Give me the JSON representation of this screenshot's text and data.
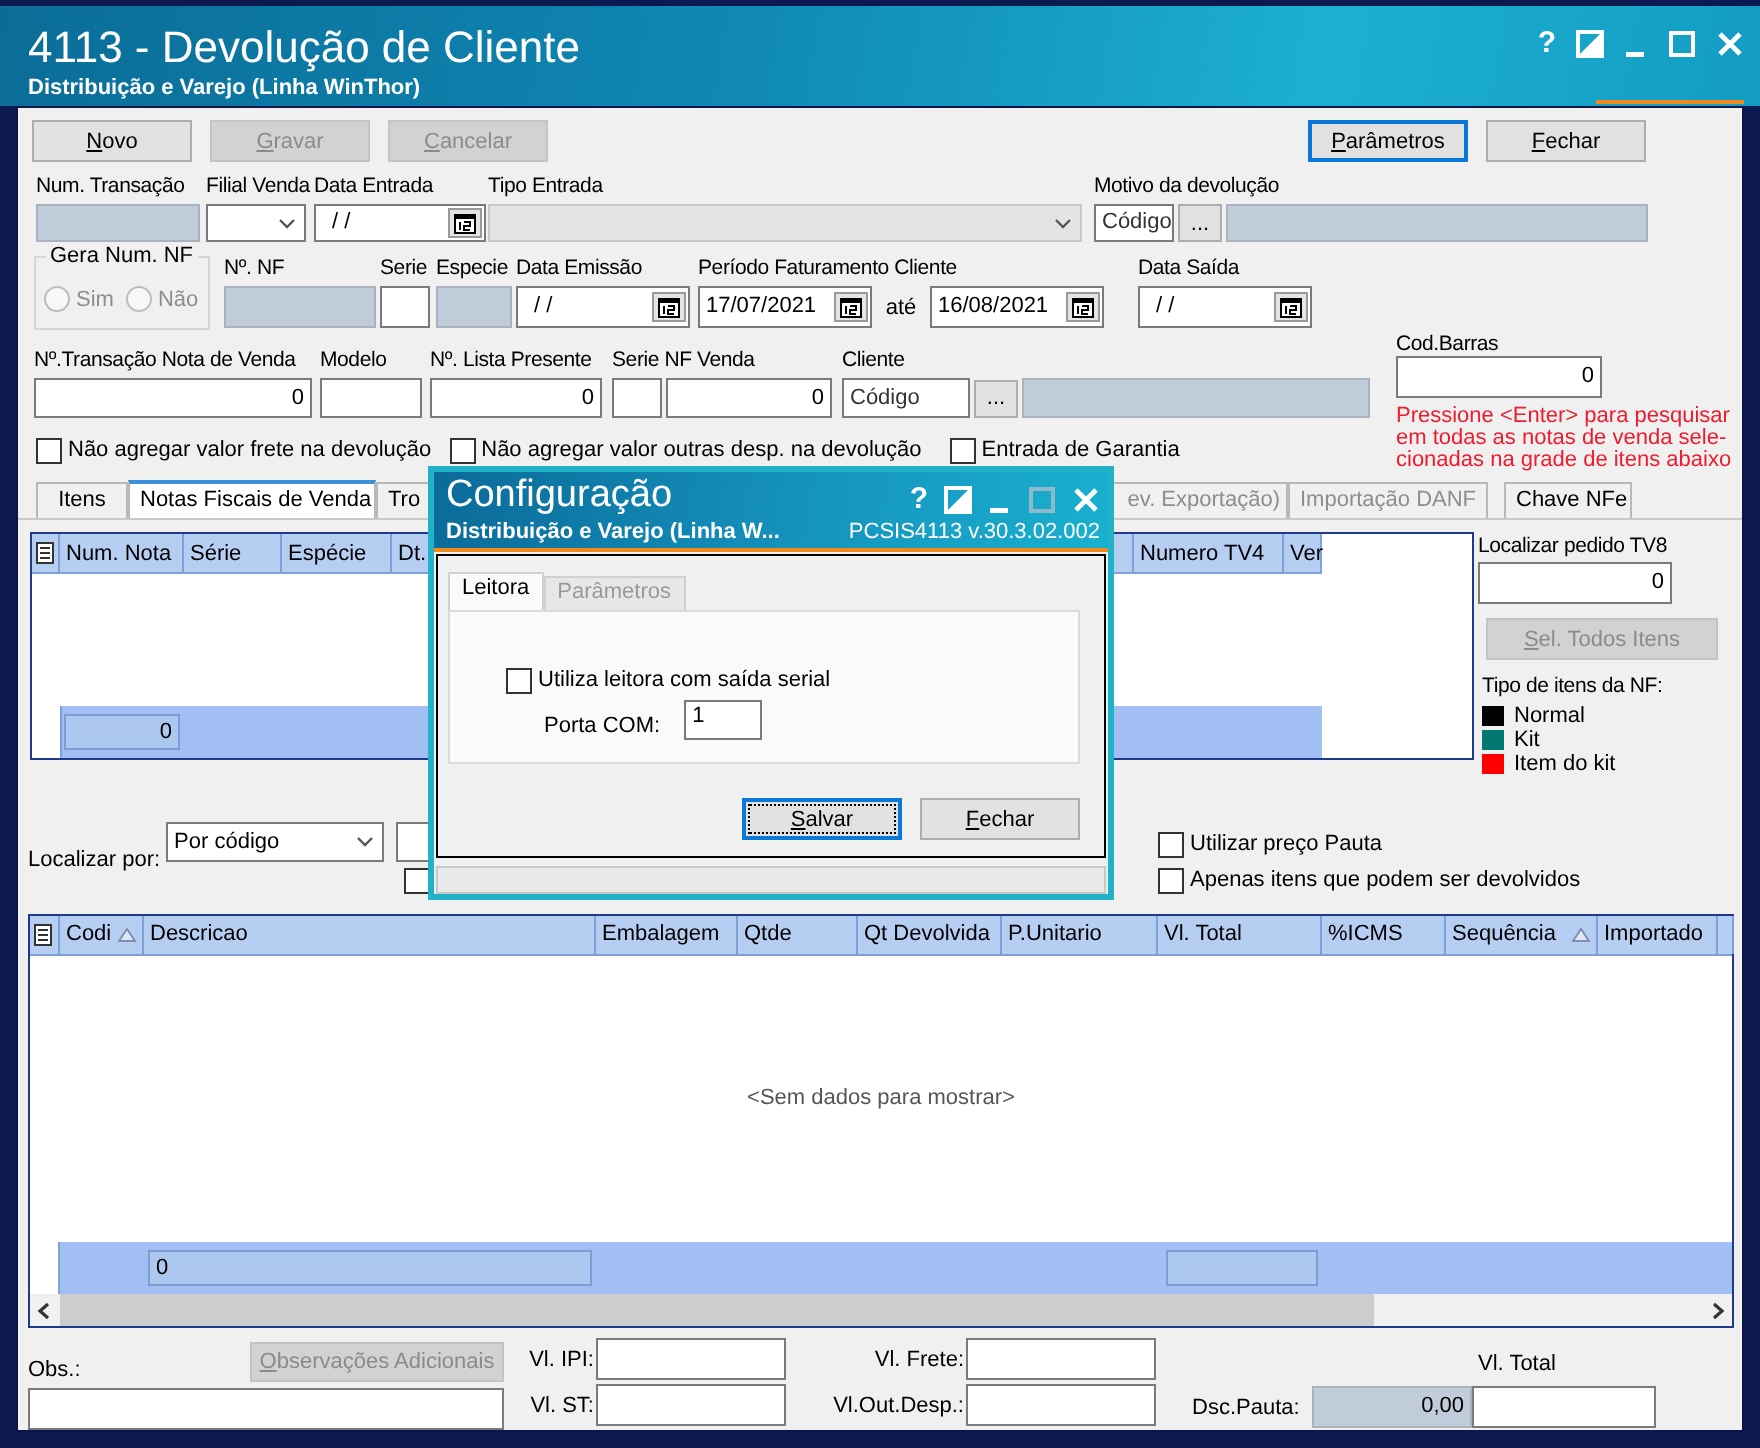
{
  "window": {
    "title": "4113 - Devolução de Cliente",
    "subtitle": "Distribuição e Varejo (Linha WinThor)",
    "help": "?",
    "maximize_disabled": false
  },
  "toolbar": [
    {
      "label": "Novo",
      "disabled": false,
      "focused": false
    },
    {
      "label": "Gravar",
      "disabled": true,
      "focused": false
    },
    {
      "label": "Cancelar",
      "disabled": true,
      "focused": false
    },
    {
      "label": "Parâmetros",
      "disabled": false,
      "focused": true
    },
    {
      "label": "Fechar",
      "disabled": false,
      "focused": false
    }
  ],
  "rows": [
    [
      {
        "kind": "readonly",
        "label": "Num. Transação"
      },
      {
        "kind": "combo",
        "label": "Filial Venda",
        "disabled": false
      },
      {
        "kind": "date",
        "label": "Data Entrada",
        "value": "/ /"
      },
      {
        "kind": "combo",
        "label": "Tipo Entrada",
        "disabled": true
      },
      {
        "kind": "lookup",
        "label": "Motivo da devolução",
        "value": "Código",
        "button": "..."
      }
    ],
    [
      {
        "kind": "radio_group",
        "label": "Gera Num. NF",
        "disabled": true,
        "options": [
          {
            "label": "Sim",
            "selected": false
          },
          {
            "label": "Não",
            "selected": false
          }
        ]
      },
      {
        "kind": "readonly",
        "label": "Nº. NF"
      },
      {
        "kind": "text",
        "label": "Serie"
      },
      {
        "kind": "readonly",
        "label": "Especie"
      },
      {
        "kind": "date",
        "label": "Data Emissão",
        "value": "/ /"
      },
      {
        "kind": "date_range",
        "label": "Período Faturamento Cliente",
        "from": "17/07/2021",
        "joiner": "até",
        "to": "16/08/2021"
      },
      {
        "kind": "date",
        "label": "Data Saída",
        "value": "/ /"
      }
    ],
    [
      {
        "kind": "text",
        "label": "Nº.Transação Nota de Venda",
        "value": "0"
      },
      {
        "kind": "text",
        "label": "Modelo"
      },
      {
        "kind": "text",
        "label": "Nº. Lista Presente",
        "value": "0"
      },
      {
        "kind": "pair",
        "label": "Serie NF Venda",
        "second_value": "0"
      },
      {
        "kind": "lookup",
        "label": "Cliente",
        "value": "Código",
        "button": "..."
      }
    ]
  ],
  "options": [
    {
      "label": "Não agregar valor frete  na devolução",
      "checked": false
    },
    {
      "label": "Não agregar valor outras desp. na devolução",
      "checked": false
    },
    {
      "label": "Entrada de Garantia",
      "checked": false
    }
  ],
  "barcode": {
    "label": "Cod.Barras",
    "value": "0",
    "hint": [
      "Pressione <Enter> para pesquisar",
      "em todas as notas de venda sele-",
      "cionadas na grade de itens abaixo"
    ]
  },
  "tabs": [
    {
      "label": "Itens",
      "selected": false,
      "disabled": false
    },
    {
      "label": "Notas Fiscais de Venda",
      "selected": true,
      "disabled": false
    },
    {
      "label": "Tro",
      "selected": false,
      "disabled": false
    },
    {
      "label": "ev. Exportação)",
      "selected": false,
      "disabled": true
    },
    {
      "label": "Importação DANF",
      "selected": false,
      "disabled": true
    },
    {
      "label": "Chave NFe",
      "selected": false,
      "disabled": false
    }
  ],
  "invoice_grid": {
    "columns": [
      "Num. Nota",
      "Série",
      "Espécie",
      "Dt.",
      "Numero TV4",
      "Ver"
    ],
    "count": "0"
  },
  "tv8": {
    "label": "Localizar pedido TV8",
    "value": "0",
    "button": "Sel. Todos Itens",
    "button_disabled": true,
    "legend_title": "Tipo de itens da NF:",
    "legend": [
      {
        "label": "Normal",
        "color": "#000000"
      },
      {
        "label": "Kit",
        "color": "#007a70"
      },
      {
        "label": "Item do kit",
        "color": "#ff0000"
      }
    ]
  },
  "search": {
    "label": "Localizar por:",
    "mode": "Por código",
    "checkbox_checked": false
  },
  "filters": [
    {
      "label": "Utilizar preço Pauta",
      "checked": false
    },
    {
      "label": "Apenas itens que podem ser devolvidos",
      "checked": false
    }
  ],
  "items_grid": {
    "columns": [
      {
        "label": "Codi",
        "sorted": true
      },
      {
        "label": "Descricao",
        "sorted": false
      },
      {
        "label": "Embalagem",
        "sorted": false
      },
      {
        "label": "Qtde",
        "sorted": false
      },
      {
        "label": "Qt Devolvida",
        "sorted": false
      },
      {
        "label": "P.Unitario",
        "sorted": false
      },
      {
        "label": "Vl. Total",
        "sorted": false
      },
      {
        "label": "%ICMS",
        "sorted": false
      },
      {
        "label": "Sequência",
        "sorted": true
      },
      {
        "label": "Importado",
        "sorted": false
      }
    ],
    "empty_text": "<Sem dados para mostrar>",
    "count": "0"
  },
  "footer": {
    "notes_button": {
      "label": "Observações Adicionais",
      "disabled": true
    },
    "obs_label": "Obs.:",
    "amounts": [
      {
        "label": "Vl. IPI:"
      },
      {
        "label": "Vl. Frete:"
      },
      {
        "label": "Vl. ST:"
      },
      {
        "label": "Vl.Out.Desp.:"
      }
    ],
    "total_label": "Vl. Total",
    "pauta_label": "Dsc.Pauta:",
    "pauta_value": "0,00"
  },
  "dialog": {
    "title": "Configuração",
    "subtitle": "Distribuição e Varejo (Linha W...",
    "version": "PCSIS4113  v.30.3.02.002",
    "help": "?",
    "maximize_disabled": true,
    "tabs": [
      {
        "label": "Leitora",
        "selected": true,
        "disabled": false
      },
      {
        "label": "Parâmetros",
        "selected": false,
        "disabled": true
      }
    ],
    "serial": {
      "label": "Utiliza leitora com saída serial",
      "checked": false
    },
    "port": {
      "label": "Porta COM:",
      "value": "1"
    },
    "buttons": [
      {
        "label": "Salvar",
        "focused": true
      },
      {
        "label": "Fechar",
        "focused": false
      }
    ]
  }
}
